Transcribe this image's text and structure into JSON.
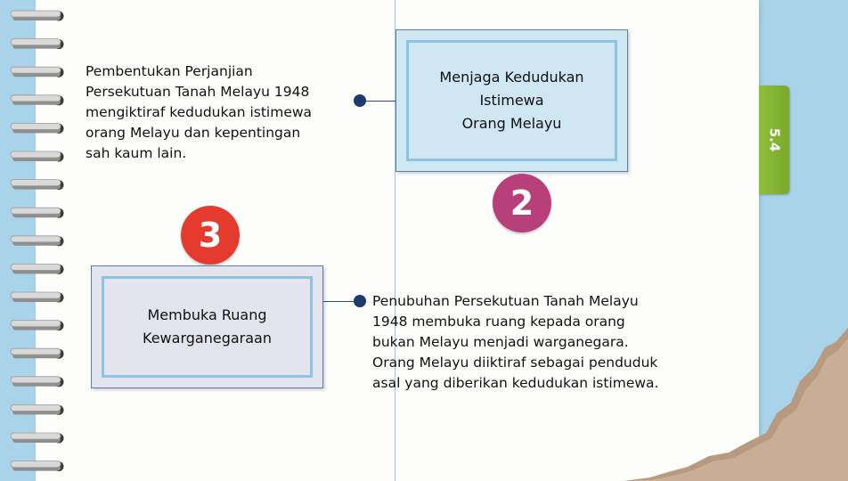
{
  "tab": {
    "label": "5.4"
  },
  "point2": {
    "number": "2",
    "title_lines": [
      "Menjaga Kedudukan",
      "Istimewa",
      "Orang Melayu"
    ],
    "description_lines": [
      "Pembentukan Perjanjian",
      "Persekutuan Tanah Melayu 1948",
      "mengiktiraf kedudukan istimewa",
      "orang Melayu dan kepentingan",
      "sah kaum lain."
    ]
  },
  "point3": {
    "number": "3",
    "title_lines": [
      "Membuka Ruang",
      "Kewarganegaraan"
    ],
    "description_lines": [
      "Penubuhan Persekutuan Tanah Melayu",
      "1948 membuka ruang kepada orang",
      "bukan Melayu menjadi warganegara.",
      "Orang Melayu diiktiraf sebagai penduduk",
      "asal yang diberikan kedudukan istimewa."
    ]
  },
  "colors": {
    "background": "#a9d3e9",
    "badge_2": "#b8407a",
    "badge_3": "#e53b2e",
    "tab": "#8fbf3a",
    "box_2_fill": "#cfe6f3",
    "box_3_fill": "#e4e4ee"
  }
}
